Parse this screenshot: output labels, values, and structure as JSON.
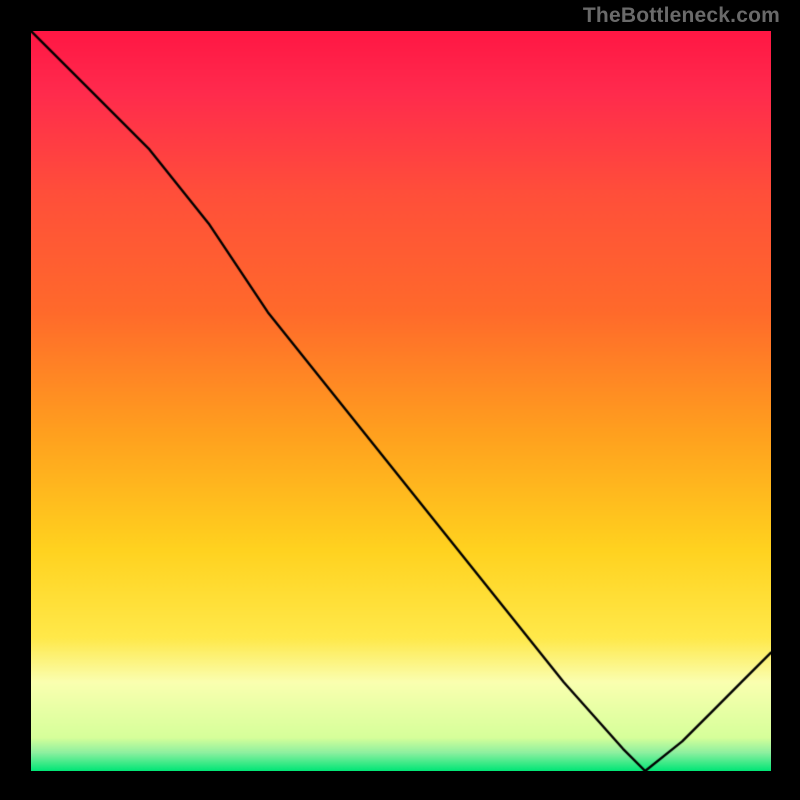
{
  "attribution": "TheBottleneck.com",
  "colors": {
    "gradient_top": "#ff1744",
    "gradient_mid_high": "#ff6a2b",
    "gradient_mid": "#ffd21f",
    "gradient_low_band": "#faffb0",
    "gradient_bottom": "#00e676",
    "line": "#000000",
    "baseline_label": "#c1272d",
    "frame": "#000000"
  },
  "chart_data": {
    "type": "line",
    "title": "",
    "xlabel": "",
    "ylabel": "",
    "xlim": [
      0,
      100
    ],
    "ylim": [
      0,
      100
    ],
    "grid": false,
    "legend": false,
    "baseline_value": 0,
    "baseline_x_fraction": 0.83,
    "series": [
      {
        "name": "bottleneck-curve",
        "x": [
          0,
          8,
          16,
          24,
          32,
          40,
          48,
          56,
          64,
          72,
          80,
          83,
          88,
          92,
          96,
          100
        ],
        "values": [
          100,
          92,
          84,
          74,
          62,
          52,
          42,
          32,
          22,
          12,
          3,
          0,
          4,
          8,
          12,
          16
        ]
      }
    ],
    "annotations": [
      {
        "text": "",
        "x_fraction": 0.83,
        "y_value": 0
      }
    ]
  }
}
